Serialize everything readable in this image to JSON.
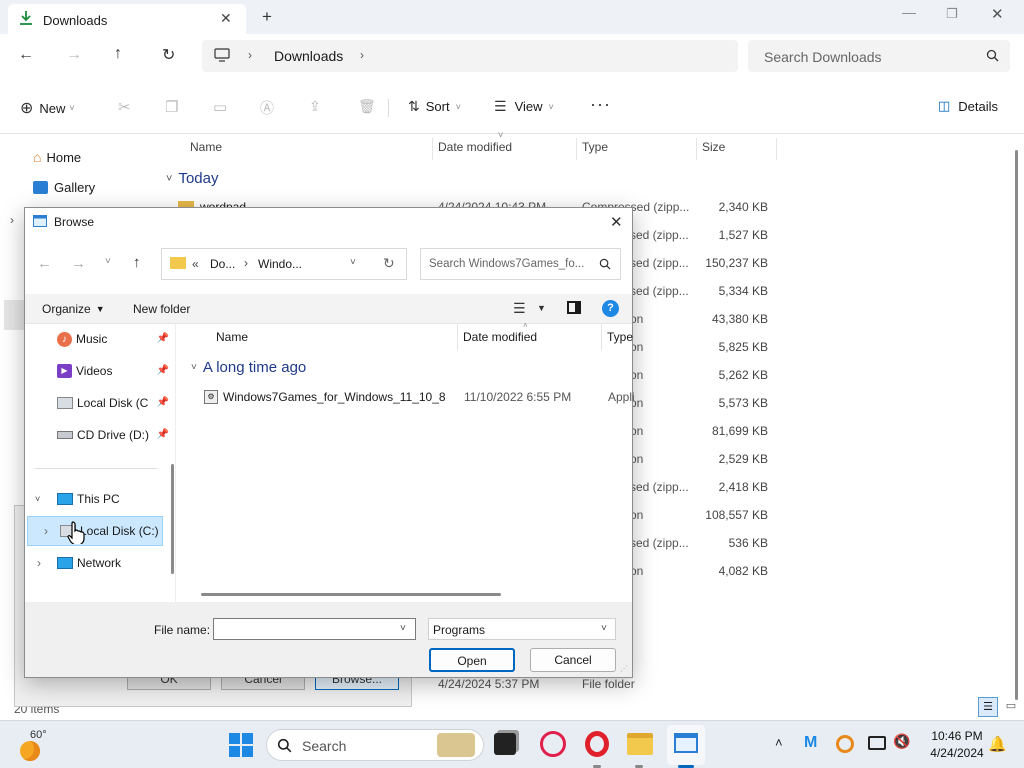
{
  "explorer": {
    "tab_title": "Downloads",
    "breadcrumb": "Downloads",
    "search_placeholder": "Search Downloads",
    "cmd": {
      "new": "New",
      "sort": "Sort",
      "view": "View",
      "details": "Details"
    },
    "nav": [
      {
        "label": "Home"
      },
      {
        "label": "Gallery"
      }
    ],
    "columns": {
      "name": "Name",
      "date": "Date modified",
      "type": "Type",
      "size": "Size"
    },
    "group_today": "Today",
    "first_row": {
      "name": "wordpad",
      "date": "4/24/2024 10:43 PM",
      "type": "Compressed (zipp..."
    },
    "sizes": [
      "2,340 KB",
      "1,527 KB",
      "150,237 KB",
      "5,334 KB",
      "43,380 KB",
      "5,825 KB",
      "5,262 KB",
      "5,573 KB",
      "81,699 KB",
      "2,529 KB",
      "2,418 KB",
      "108,557 KB",
      "536 KB",
      "4,082 KB"
    ],
    "types": [
      "Compressed (zipp...",
      "sed (zipp...",
      "sed (zipp...",
      "sed (zipp...",
      "on",
      "on",
      "on",
      "on",
      "on",
      "on",
      "sed (zipp...",
      "on",
      "sed (zipp...",
      "on"
    ],
    "last_row": {
      "date": "4/24/2024 5:37 PM",
      "type": "File folder"
    },
    "status": "20 items"
  },
  "back_dialog": {
    "ok": "OK",
    "cancel": "Cancel",
    "browse": "Browse..."
  },
  "dialog": {
    "title": "Browse",
    "addr_part1": "Do...",
    "addr_part2": "Windo...",
    "search_placeholder": "Search Windows7Games_fo...",
    "organize": "Organize",
    "new_folder": "New folder",
    "nav": [
      {
        "label": "Music",
        "icon": "music-icon"
      },
      {
        "label": "Videos",
        "icon": "videos-icon"
      },
      {
        "label": "Local Disk (C",
        "icon": "drive-icon"
      },
      {
        "label": "CD Drive (D:)",
        "icon": "cd-drive-icon"
      }
    ],
    "this_pc": "This PC",
    "local_disk": "Local Disk (C:)",
    "network": "Network",
    "columns": {
      "name": "Name",
      "date": "Date modified",
      "type": "Type"
    },
    "group": "A long time ago",
    "file": {
      "name": "Windows7Games_for_Windows_11_10_8",
      "date": "11/10/2022 6:55 PM",
      "type": "Appli"
    },
    "file_name_label": "File name:",
    "file_name_value": "",
    "filter": "Programs",
    "open": "Open",
    "cancel": "Cancel"
  },
  "taskbar": {
    "weather": "60°",
    "search_placeholder": "Search",
    "time": "10:46 PM",
    "date": "4/24/2024"
  }
}
